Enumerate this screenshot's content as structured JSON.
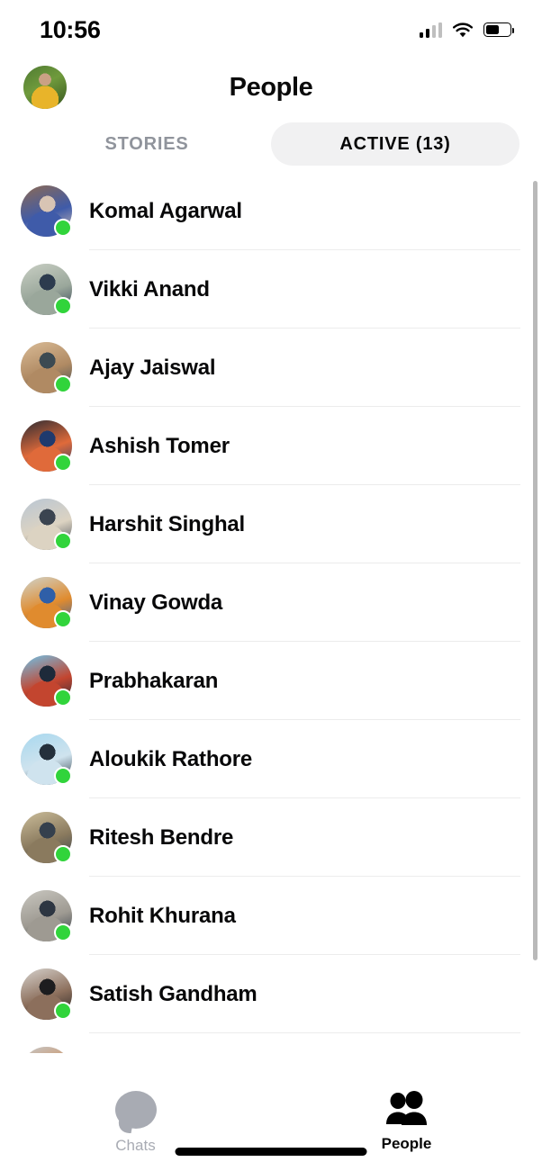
{
  "status_bar": {
    "time": "10:56",
    "signal_icon": "cellular-signal-icon",
    "signal_bars_filled": 2,
    "signal_bars_total": 4,
    "wifi_icon": "wifi-icon",
    "battery_icon": "battery-icon",
    "battery_level_percent": 55
  },
  "header": {
    "title": "People",
    "avatar_icon": "profile-avatar"
  },
  "segments": {
    "stories_label": "STORIES",
    "active_label": "ACTIVE (13)",
    "selected": "ACTIVE (13)"
  },
  "people": [
    {
      "name": "Komal Agarwal",
      "status": "active",
      "avatar_colors": [
        "#8d6a52",
        "#d8c4b4",
        "#3f5ba9"
      ]
    },
    {
      "name": "Vikki Anand",
      "status": "active",
      "avatar_colors": [
        "#c9cfc4",
        "#2c3b4e",
        "#9aa79b"
      ]
    },
    {
      "name": "Ajay Jaiswal",
      "status": "active",
      "avatar_colors": [
        "#d9bb96",
        "#3c4a52",
        "#b08a63"
      ]
    },
    {
      "name": "Ashish Tomer",
      "status": "active",
      "avatar_colors": [
        "#2b2b33",
        "#1f3a6e",
        "#e06a3a"
      ]
    },
    {
      "name": "Harshit Singhal",
      "status": "active",
      "avatar_colors": [
        "#b9c6d4",
        "#3b4450",
        "#dcd3c2"
      ]
    },
    {
      "name": "Vinay Gowda",
      "status": "active",
      "avatar_colors": [
        "#cfd4cd",
        "#2f5fa8",
        "#e08b2e"
      ]
    },
    {
      "name": "Prabhakaran",
      "status": "active",
      "avatar_colors": [
        "#6ec4ea",
        "#1e2a3a",
        "#c3452f"
      ]
    },
    {
      "name": "Aloukik Rathore",
      "status": "active",
      "avatar_colors": [
        "#a7d8ef",
        "#24303c",
        "#cfe3ee"
      ]
    },
    {
      "name": "Ritesh Bendre",
      "status": "active",
      "avatar_colors": [
        "#cbbd9a",
        "#35404d",
        "#8a7a5e"
      ]
    },
    {
      "name": "Rohit Khurana",
      "status": "active",
      "avatar_colors": [
        "#c9c7c0",
        "#2d3642",
        "#9e9a92"
      ]
    },
    {
      "name": "Satish Gandham",
      "status": "active",
      "avatar_colors": [
        "#d6d2cd",
        "#1d1d1f",
        "#8c6f5c"
      ]
    },
    {
      "name": "",
      "status": "active",
      "avatar_colors": [
        "#c5c9cc",
        "#4a4f58",
        "#d08a52"
      ]
    }
  ],
  "scrollbar": {
    "name": "list-scrollbar"
  },
  "tab_bar": {
    "tabs": [
      {
        "label": "Chats",
        "icon": "chat-bubble-icon",
        "active": false
      },
      {
        "label": "People",
        "icon": "people-icon",
        "active": true
      }
    ]
  },
  "colors": {
    "active_dot": "#31d43b",
    "segment_active_bg": "#f1f1f2",
    "inactive_text": "#90949c",
    "divider": "#ececec",
    "tab_inactive": "#a8abb3"
  }
}
